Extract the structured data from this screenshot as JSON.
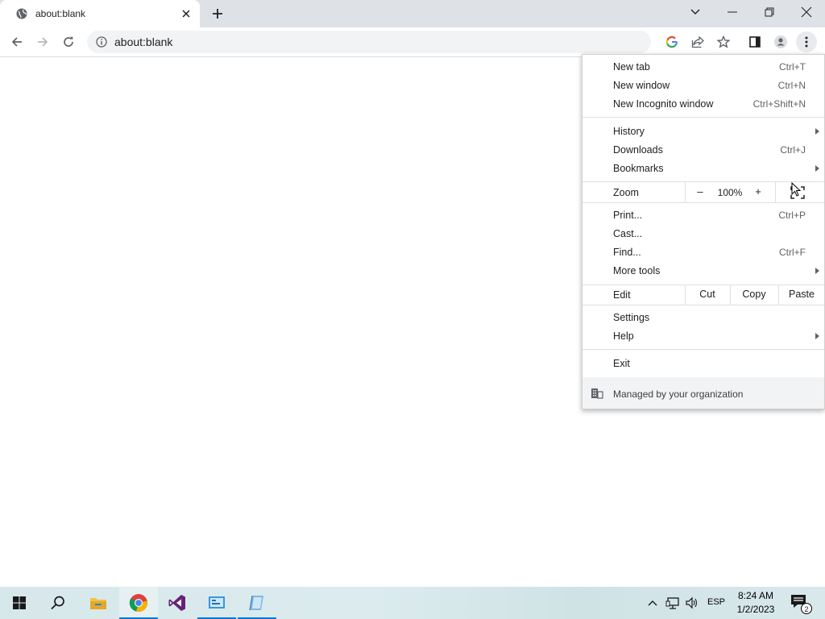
{
  "browser": {
    "tab": {
      "title": "about:blank",
      "favicon": "globe-icon",
      "close_icon": "close-icon"
    },
    "new_tab_icon": "plus-icon",
    "window_controls": [
      "tab-search-icon",
      "minimize-icon",
      "restore-icon",
      "close-icon"
    ],
    "toolbar": {
      "back_icon": "back-arrow-icon",
      "forward_icon": "forward-arrow-icon",
      "reload_icon": "reload-icon",
      "url": "about:blank",
      "site_info_icon": "info-icon",
      "actions": [
        "google-icon",
        "share-icon",
        "star-icon",
        "side-panel-icon",
        "profile-icon",
        "kebab-menu-icon"
      ]
    }
  },
  "menu": {
    "new_tab": {
      "label": "New tab",
      "shortcut": "Ctrl+T"
    },
    "new_window": {
      "label": "New window",
      "shortcut": "Ctrl+N"
    },
    "new_incognito": {
      "label": "New Incognito window",
      "shortcut": "Ctrl+Shift+N"
    },
    "history": {
      "label": "History"
    },
    "downloads": {
      "label": "Downloads",
      "shortcut": "Ctrl+J"
    },
    "bookmarks": {
      "label": "Bookmarks"
    },
    "zoom": {
      "label": "Zoom",
      "minus": "–",
      "value": "100%",
      "plus": "+",
      "fullscreen_icon": "fullscreen-icon"
    },
    "print": {
      "label": "Print...",
      "shortcut": "Ctrl+P"
    },
    "cast": {
      "label": "Cast..."
    },
    "find": {
      "label": "Find...",
      "shortcut": "Ctrl+F"
    },
    "more_tools": {
      "label": "More tools"
    },
    "edit": {
      "label": "Edit",
      "cut": "Cut",
      "copy": "Copy",
      "paste": "Paste"
    },
    "settings": {
      "label": "Settings"
    },
    "help": {
      "label": "Help"
    },
    "exit": {
      "label": "Exit"
    },
    "managed": {
      "label": "Managed by your organization",
      "icon": "building-icon"
    }
  },
  "taskbar": {
    "items": [
      "windows-start-icon",
      "search-icon",
      "file-explorer-icon",
      "chrome-icon",
      "visual-studio-icon",
      "control-panel-icon",
      "app-icon"
    ],
    "active": "chrome-icon",
    "tray": {
      "language": "ESP",
      "time": "8:24 AM",
      "date": "1/2/2023",
      "notifications": "2"
    }
  },
  "colors": {
    "accent": "#0078d7",
    "tabstrip": "#dee1e6",
    "omnibox": "#f1f3f4"
  }
}
